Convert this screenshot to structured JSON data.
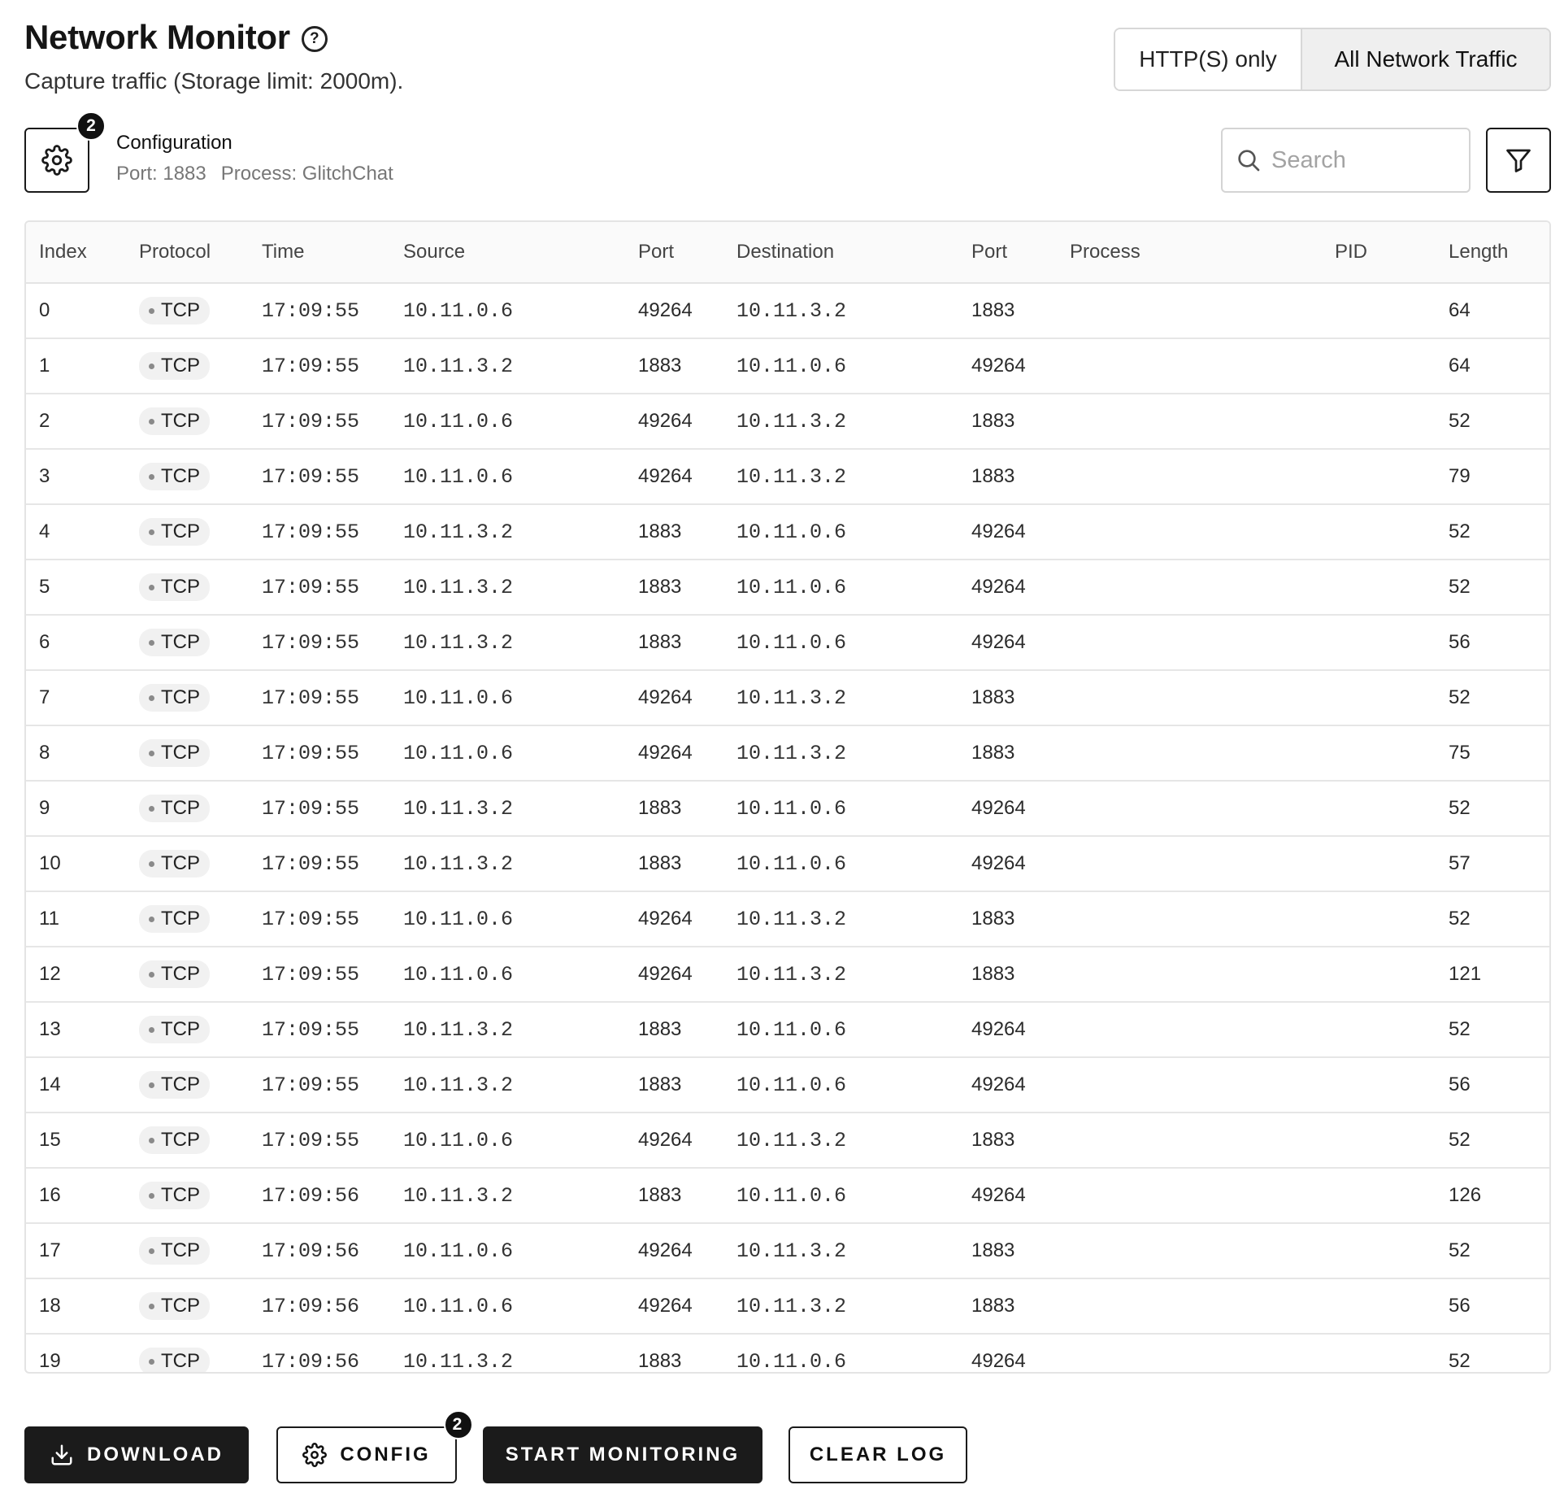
{
  "header": {
    "title": "Network Monitor",
    "help_icon": "question-circle-icon",
    "subtitle": "Capture traffic (Storage limit: 2000m)."
  },
  "mode_toggle": {
    "options": [
      {
        "label": "HTTP(S) only",
        "selected": false
      },
      {
        "label": "All Network Traffic",
        "selected": true
      }
    ]
  },
  "configuration": {
    "icon": "gear-icon",
    "badge_count": "2",
    "title": "Configuration",
    "port_text": "Port: 1883",
    "process_text": "Process: GlitchChat"
  },
  "search": {
    "placeholder": "Search",
    "value": ""
  },
  "filter": {
    "icon": "filter-icon"
  },
  "table": {
    "columns": [
      "Index",
      "Protocol",
      "Time",
      "Source",
      "Port",
      "Destination",
      "Port",
      "Process",
      "PID",
      "Length"
    ],
    "rows": [
      [
        "0",
        "TCP",
        "17:09:55",
        "10.11.0.6",
        "49264",
        "10.11.3.2",
        "1883",
        "",
        "",
        "64"
      ],
      [
        "1",
        "TCP",
        "17:09:55",
        "10.11.3.2",
        "1883",
        "10.11.0.6",
        "49264",
        "",
        "",
        "64"
      ],
      [
        "2",
        "TCP",
        "17:09:55",
        "10.11.0.6",
        "49264",
        "10.11.3.2",
        "1883",
        "",
        "",
        "52"
      ],
      [
        "3",
        "TCP",
        "17:09:55",
        "10.11.0.6",
        "49264",
        "10.11.3.2",
        "1883",
        "",
        "",
        "79"
      ],
      [
        "4",
        "TCP",
        "17:09:55",
        "10.11.3.2",
        "1883",
        "10.11.0.6",
        "49264",
        "",
        "",
        "52"
      ],
      [
        "5",
        "TCP",
        "17:09:55",
        "10.11.3.2",
        "1883",
        "10.11.0.6",
        "49264",
        "",
        "",
        "52"
      ],
      [
        "6",
        "TCP",
        "17:09:55",
        "10.11.3.2",
        "1883",
        "10.11.0.6",
        "49264",
        "",
        "",
        "56"
      ],
      [
        "7",
        "TCP",
        "17:09:55",
        "10.11.0.6",
        "49264",
        "10.11.3.2",
        "1883",
        "",
        "",
        "52"
      ],
      [
        "8",
        "TCP",
        "17:09:55",
        "10.11.0.6",
        "49264",
        "10.11.3.2",
        "1883",
        "",
        "",
        "75"
      ],
      [
        "9",
        "TCP",
        "17:09:55",
        "10.11.3.2",
        "1883",
        "10.11.0.6",
        "49264",
        "",
        "",
        "52"
      ],
      [
        "10",
        "TCP",
        "17:09:55",
        "10.11.3.2",
        "1883",
        "10.11.0.6",
        "49264",
        "",
        "",
        "57"
      ],
      [
        "11",
        "TCP",
        "17:09:55",
        "10.11.0.6",
        "49264",
        "10.11.3.2",
        "1883",
        "",
        "",
        "52"
      ],
      [
        "12",
        "TCP",
        "17:09:55",
        "10.11.0.6",
        "49264",
        "10.11.3.2",
        "1883",
        "",
        "",
        "121"
      ],
      [
        "13",
        "TCP",
        "17:09:55",
        "10.11.3.2",
        "1883",
        "10.11.0.6",
        "49264",
        "",
        "",
        "52"
      ],
      [
        "14",
        "TCP",
        "17:09:55",
        "10.11.3.2",
        "1883",
        "10.11.0.6",
        "49264",
        "",
        "",
        "56"
      ],
      [
        "15",
        "TCP",
        "17:09:55",
        "10.11.0.6",
        "49264",
        "10.11.3.2",
        "1883",
        "",
        "",
        "52"
      ],
      [
        "16",
        "TCP",
        "17:09:56",
        "10.11.3.2",
        "1883",
        "10.11.0.6",
        "49264",
        "",
        "",
        "126"
      ],
      [
        "17",
        "TCP",
        "17:09:56",
        "10.11.0.6",
        "49264",
        "10.11.3.2",
        "1883",
        "",
        "",
        "52"
      ],
      [
        "18",
        "TCP",
        "17:09:56",
        "10.11.0.6",
        "49264",
        "10.11.3.2",
        "1883",
        "",
        "",
        "56"
      ],
      [
        "19",
        "TCP",
        "17:09:56",
        "10.11.3.2",
        "1883",
        "10.11.0.6",
        "49264",
        "",
        "",
        "52"
      ]
    ]
  },
  "actions": {
    "download_label": "DOWNLOAD",
    "download_icon": "download-icon",
    "config_label": "CONFIG",
    "config_icon": "gear-icon",
    "config_badge": "2",
    "start_label": "START MONITORING",
    "clear_label": "CLEAR LOG"
  }
}
